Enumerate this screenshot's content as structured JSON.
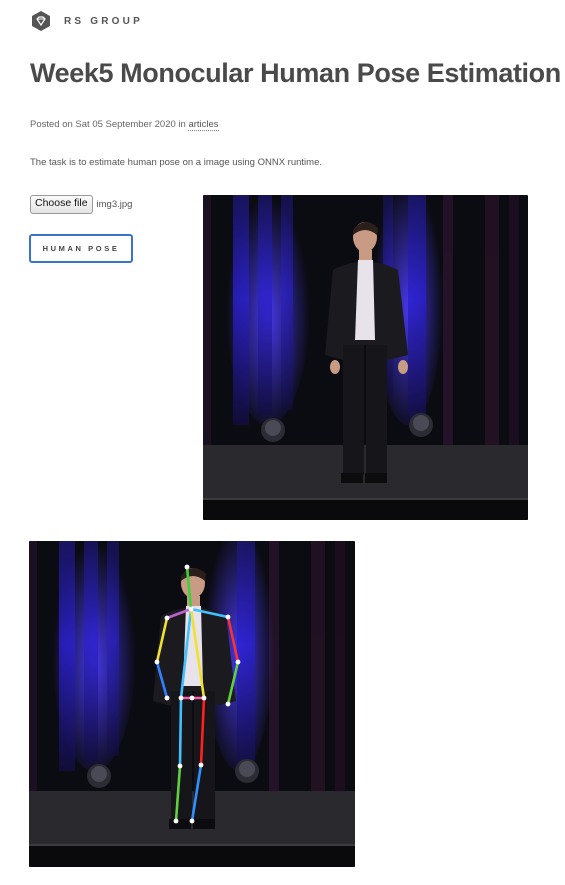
{
  "header": {
    "brand": "RS GROUP",
    "logo_icon": "diamond-gem-icon"
  },
  "article": {
    "title": "Week5 Monocular Human Pose Estimation",
    "meta_prefix": "Posted on Sat 05 September 2020 in ",
    "category_link": "articles",
    "description": "The task is to estimate human pose on a image using ONNX runtime."
  },
  "file_input": {
    "button_label": "Choose file",
    "file_name": "img3.jpg"
  },
  "actions": {
    "pose_button_label": "HUMAN POSE"
  },
  "colors": {
    "title": "#4a4a4a",
    "button_border": "#3b73c7",
    "stage_bg": "#0b0b12",
    "spotlight": "#3a2cff"
  },
  "skeleton": {
    "limb_colors": {
      "head": "#3cd23c",
      "neck_left": "#c060d0",
      "neck_right": "#40c0ff",
      "left_arm": "#f0e030",
      "right_arm": "#ff3030",
      "right_forearm": "#60d040",
      "left_forearm": "#3080ff",
      "torso": "#40c0ff",
      "hips": "#ff5ab0",
      "left_thigh": "#40c0ff",
      "right_thigh": "#ff2020",
      "left_shin": "#60d040",
      "right_shin": "#3090ff"
    }
  }
}
